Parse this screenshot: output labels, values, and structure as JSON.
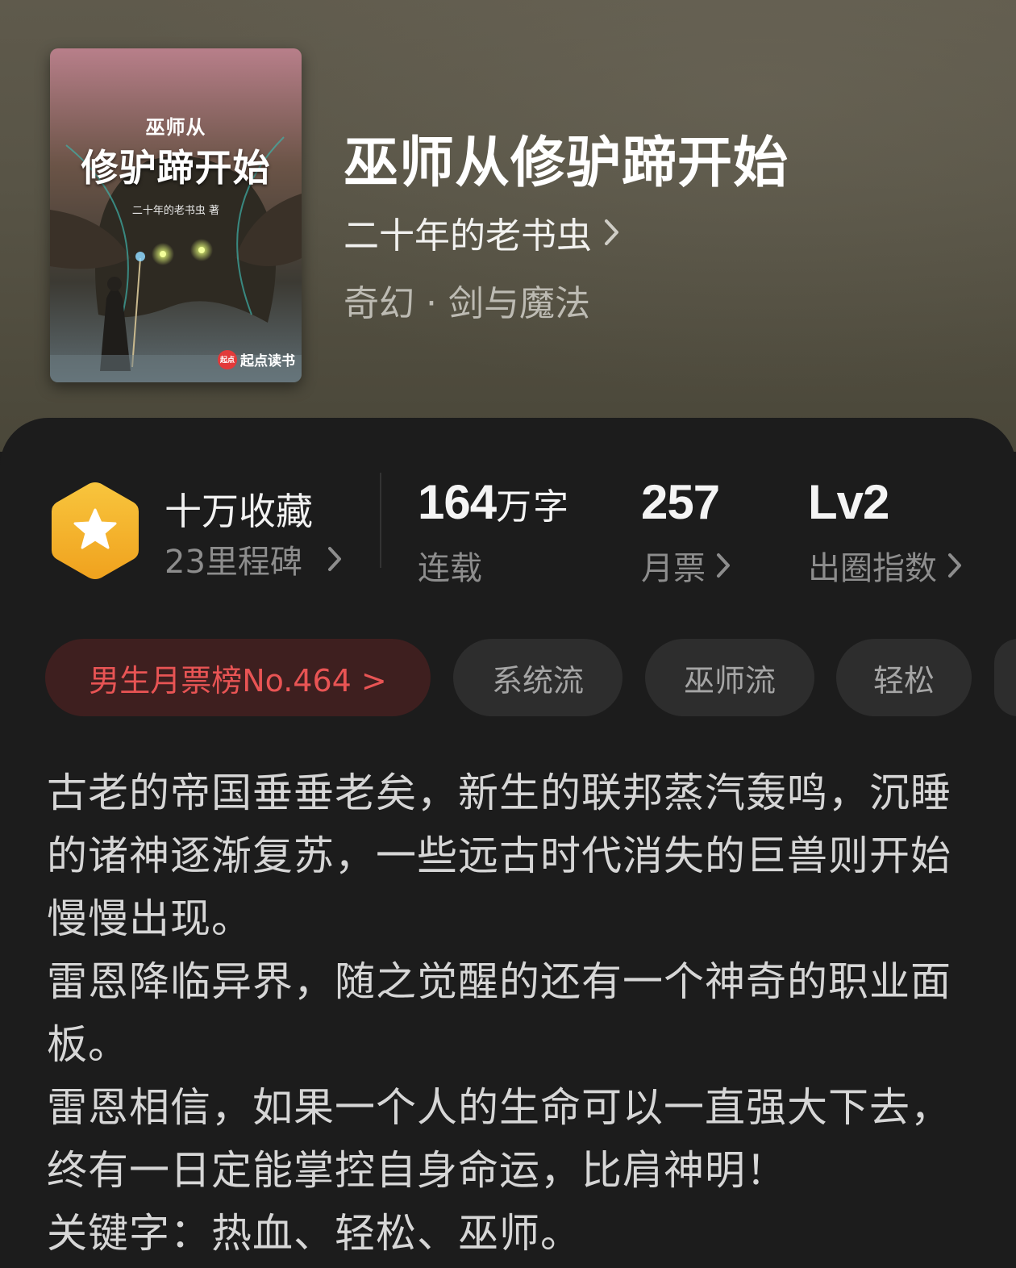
{
  "book": {
    "title": "巫师从修驴蹄开始",
    "author": "二十年的老书虫",
    "genre": "奇幻 · 剑与魔法"
  },
  "cover": {
    "title_small": "巫师从",
    "title_big": "修驴蹄开始",
    "author": "二十年的老书虫 著",
    "brand_logo": "起点",
    "brand": "起点读书"
  },
  "stats": {
    "collection_label": "十万收藏",
    "milestone": "23里程碑",
    "word_count_num": "164",
    "word_count_unit": "万字",
    "status": "连载",
    "monthly_votes": "257",
    "monthly_votes_label": "月票",
    "level": "Lv2",
    "level_label": "出圈指数"
  },
  "tags": [
    "男生月票榜No.464 >",
    "系统流",
    "巫师流",
    "轻松"
  ],
  "synopsis": [
    "古老的帝国垂垂老矣，新生的联邦蒸汽轰鸣，沉睡的诸神逐渐复苏，一些远古时代消失的巨兽则开始慢慢出现。",
    "雷恩降临异界，随之觉醒的还有一个神奇的职业面板。",
    "雷恩相信，如果一个人的生命可以一直强大下去，终有一日定能掌控自身命运，比肩神明！",
    "关键字：热血、轻松、巫师。"
  ],
  "colors": {
    "accent_rank": "#e85454",
    "badge_gold": "#f5b731"
  },
  "icons": {
    "chevron": "chevron-right-icon",
    "badge": "star-hexagon-icon"
  }
}
